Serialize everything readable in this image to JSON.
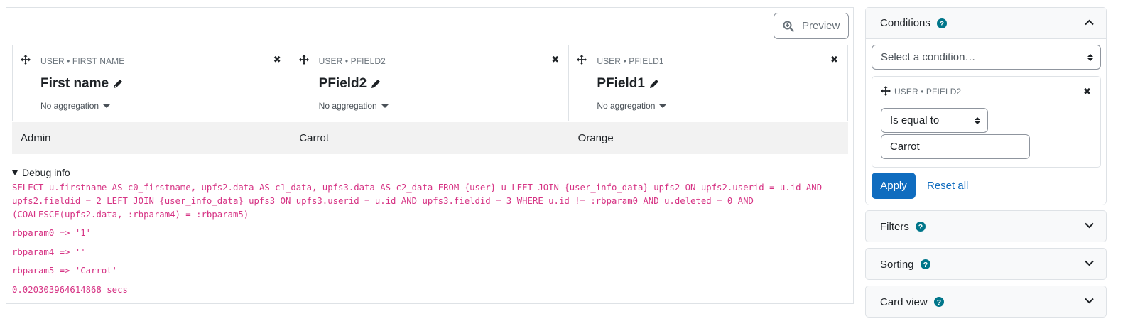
{
  "toolbar": {
    "preview_label": "Preview"
  },
  "columns": [
    {
      "tag": "USER • FIRST NAME",
      "title": "First name",
      "aggregation": "No aggregation"
    },
    {
      "tag": "USER • PFIELD2",
      "title": "PField2",
      "aggregation": "No aggregation"
    },
    {
      "tag": "USER • PFIELD1",
      "title": "PField1",
      "aggregation": "No aggregation"
    }
  ],
  "rows": [
    [
      "Admin",
      "Carrot",
      "Orange"
    ]
  ],
  "debug": {
    "summary": "Debug info",
    "sql": "SELECT u.firstname AS c0_firstname, upfs2.data AS c1_data, upfs3.data AS c2_data FROM {user} u LEFT JOIN {user_info_data} upfs2 ON upfs2.userid = u.id AND upfs2.fieldid = 2 LEFT JOIN {user_info_data} upfs3 ON upfs3.userid = u.id AND upfs3.fieldid = 3 WHERE u.id != :rbparam0 AND u.deleted = 0 AND (COALESCE(upfs2.data, :rbparam4) = :rbparam5)",
    "param0": "rbparam0 => '1'",
    "param4": "rbparam4 => ''",
    "param5": "rbparam5 => 'Carrot'",
    "time": "0.020303964614868 secs"
  },
  "sidebar": {
    "conditions": {
      "title": "Conditions",
      "select_placeholder": "Select a condition…",
      "item": {
        "tag": "USER • PFIELD2",
        "operator": "Is equal to",
        "value": "Carrot"
      },
      "apply_label": "Apply",
      "reset_label": "Reset all"
    },
    "filters_title": "Filters",
    "sorting_title": "Sorting",
    "cardview_title": "Card view"
  },
  "colors": {
    "primary": "#0f6cbf",
    "help": "#00768a",
    "code": "#d63384"
  }
}
